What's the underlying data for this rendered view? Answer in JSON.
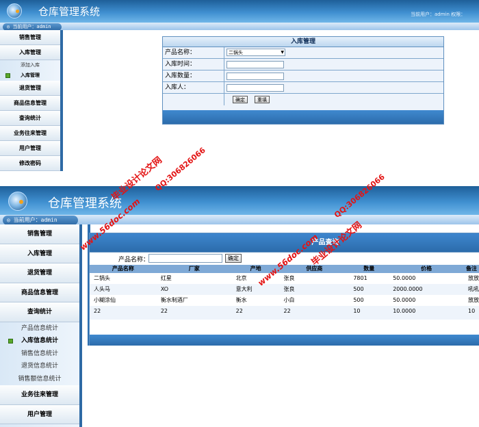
{
  "top": {
    "app_title": "仓库管理系统",
    "current_user_text": "当前用户：admin",
    "header_right_text": "当前用户：admin  权限：",
    "menu": [
      {
        "label": "销售管理"
      },
      {
        "label": "入库管理"
      }
    ],
    "submenu": [
      {
        "label": "添加入库",
        "active": false
      },
      {
        "label": "入库管理",
        "active": true
      }
    ],
    "menu_after": [
      {
        "label": "退货管理"
      },
      {
        "label": "商品信息管理"
      },
      {
        "label": "查询统计"
      },
      {
        "label": "业务往来管理"
      },
      {
        "label": "用户管理"
      },
      {
        "label": "修改密码"
      }
    ],
    "form": {
      "title": "入库管理",
      "product_label": "产品名称：",
      "product_value": "二锅头",
      "time_label": "入库时间：",
      "qty_label": "入库数量：",
      "person_label": "入库人：",
      "confirm": "确定",
      "reset": "重填"
    }
  },
  "bottom": {
    "app_title": "仓库管理系统",
    "current_user_text": "当前用户：admin",
    "menu_before": [
      {
        "label": "销售管理"
      },
      {
        "label": "入库管理"
      },
      {
        "label": "退货管理"
      },
      {
        "label": "商品信息管理"
      },
      {
        "label": "查询统计"
      }
    ],
    "submenu": [
      {
        "label": "产品信息统计",
        "active": false
      },
      {
        "label": "入库信息统计",
        "active": true
      },
      {
        "label": "销售信息统计",
        "active": false
      },
      {
        "label": "退货信息统计",
        "active": false
      },
      {
        "label": "销售额信息统计",
        "active": false
      }
    ],
    "menu_after": [
      {
        "label": "业务往来管理"
      },
      {
        "label": "用户管理"
      }
    ],
    "query": {
      "title": "产品查询",
      "search_label": "产品名称：",
      "search_value": "",
      "confirm": "确定",
      "columns": [
        "产品名称",
        "厂家",
        "产地",
        "供应商",
        "数量",
        "价格",
        "备注"
      ],
      "rows": [
        [
          "二锅头",
          "红星",
          "北京",
          "张良",
          "7801",
          "50.0000",
          "放放风"
        ],
        [
          "人头马",
          "XO",
          "意大利",
          "张良",
          "500",
          "2000.0000",
          "吼吼吼"
        ],
        [
          "小糊涂仙",
          "衡水制酒厂",
          "衡水",
          "小白",
          "500",
          "50.0000",
          "放放风"
        ],
        [
          "22",
          "22",
          "22",
          "22",
          "10",
          "10.0000",
          "10"
        ]
      ]
    }
  },
  "watermarks": {
    "site_name": "毕业设计论文网",
    "qq": "QQ:306826066",
    "url": "www.56doc.com"
  }
}
